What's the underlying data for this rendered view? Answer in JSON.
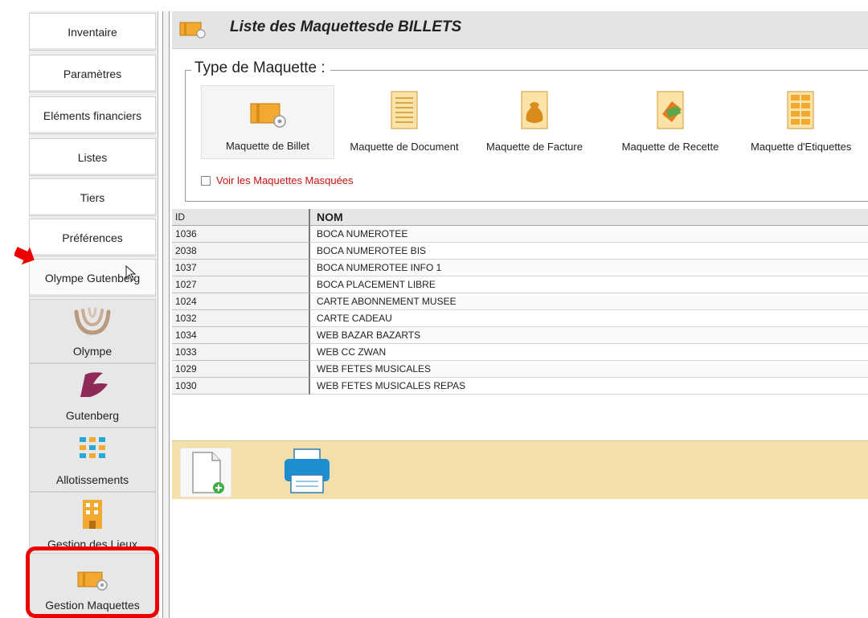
{
  "sidebar": {
    "items": [
      {
        "label": "Inventaire"
      },
      {
        "label": "Paramètres"
      },
      {
        "label": "Eléments financiers"
      },
      {
        "label": "Listes"
      },
      {
        "label": "Tiers"
      },
      {
        "label": "Préférences"
      },
      {
        "label": "Olympe Gutenberg"
      }
    ],
    "modules": [
      {
        "label": "Olympe",
        "icon": "olympe-logo-icon"
      },
      {
        "label": "Gutenberg",
        "icon": "gutenberg-logo-icon"
      },
      {
        "label": "Allotissements",
        "icon": "allotment-seats-icon"
      },
      {
        "label": "Gestion des Lieux",
        "icon": "building-icon"
      },
      {
        "label": "Gestion Maquettes",
        "icon": "ticket-template-icon"
      }
    ]
  },
  "header": {
    "title": "Liste des Maquettesde BILLETS",
    "icon": "ticket-template-icon"
  },
  "type_group": {
    "legend": "Type de Maquette :",
    "types": [
      {
        "label": "Maquette de Billet",
        "icon": "ticket-icon"
      },
      {
        "label": "Maquette de Document",
        "icon": "document-icon"
      },
      {
        "label": "Maquette de Facture",
        "icon": "money-bag-icon"
      },
      {
        "label": "Maquette de Recette",
        "icon": "receipt-icon"
      },
      {
        "label": "Maquette d'Etiquettes",
        "icon": "labels-icon"
      }
    ],
    "show_hidden_label": "Voir les Maquettes Masquées",
    "show_hidden_checked": false
  },
  "table": {
    "columns": [
      "ID",
      "NOM"
    ],
    "rows": [
      [
        "1036",
        "BOCA NUMEROTEE"
      ],
      [
        "2038",
        "BOCA NUMEROTEE BIS"
      ],
      [
        "1037",
        "BOCA NUMEROTEE INFO 1"
      ],
      [
        "1027",
        "BOCA PLACEMENT LIBRE"
      ],
      [
        "1024",
        "CARTE ABONNEMENT MUSEE"
      ],
      [
        "1032",
        "CARTE CADEAU"
      ],
      [
        "1034",
        "WEB BAZAR BAZARTS"
      ],
      [
        "1033",
        "WEB CC ZWAN"
      ],
      [
        "1029",
        "WEB FETES MUSICALES"
      ],
      [
        "1030",
        "WEB FETES MUSICALES REPAS"
      ]
    ]
  },
  "toolbar": {
    "new_icon": "new-document-icon",
    "print_icon": "printer-icon"
  },
  "colors": {
    "highlight": "#ee0000",
    "toolbar_bg": "#f3dfaa",
    "hidden_label": "#cc1111"
  }
}
